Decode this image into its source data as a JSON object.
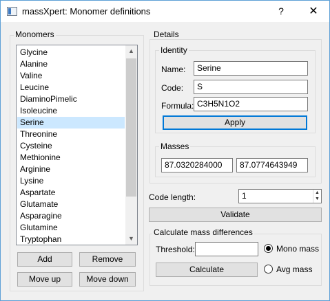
{
  "window": {
    "title": "massXpert: Monomer definitions",
    "help_label": "?",
    "close_label": "✕",
    "icon": "app-window-icon"
  },
  "monomers": {
    "title": "Monomers",
    "items": [
      "Glycine",
      "Alanine",
      "Valine",
      "Leucine",
      "DiaminoPimelic",
      "Isoleucine",
      "Serine",
      "Threonine",
      "Cysteine",
      "Methionine",
      "Arginine",
      "Lysine",
      "Aspartate",
      "Glutamate",
      "Asparagine",
      "Glutamine",
      "Tryptophan"
    ],
    "selected": "Serine",
    "add_label": "Add",
    "remove_label": "Remove",
    "move_up_label": "Move up",
    "move_down_label": "Move down"
  },
  "details": {
    "title": "Details",
    "identity": {
      "title": "Identity",
      "name_label": "Name:",
      "name_value": "Serine",
      "code_label": "Code:",
      "code_value": "S",
      "formula_label": "Formula:",
      "formula_value": "C3H5N1O2",
      "apply_label": "Apply"
    },
    "masses": {
      "title": "Masses",
      "mono": "87.0320284000",
      "avg": "87.0774643949"
    },
    "code_length_label": "Code length:",
    "code_length_value": "1",
    "validate_label": "Validate"
  },
  "mass_diff": {
    "title": "Calculate mass differences",
    "threshold_label": "Threshold:",
    "threshold_value": "",
    "calculate_label": "Calculate",
    "mono_label": "Mono mass",
    "avg_label": "Avg mass",
    "selected": "mono"
  },
  "colors": {
    "selection": "#cce8ff",
    "accent": "#0078d7"
  }
}
